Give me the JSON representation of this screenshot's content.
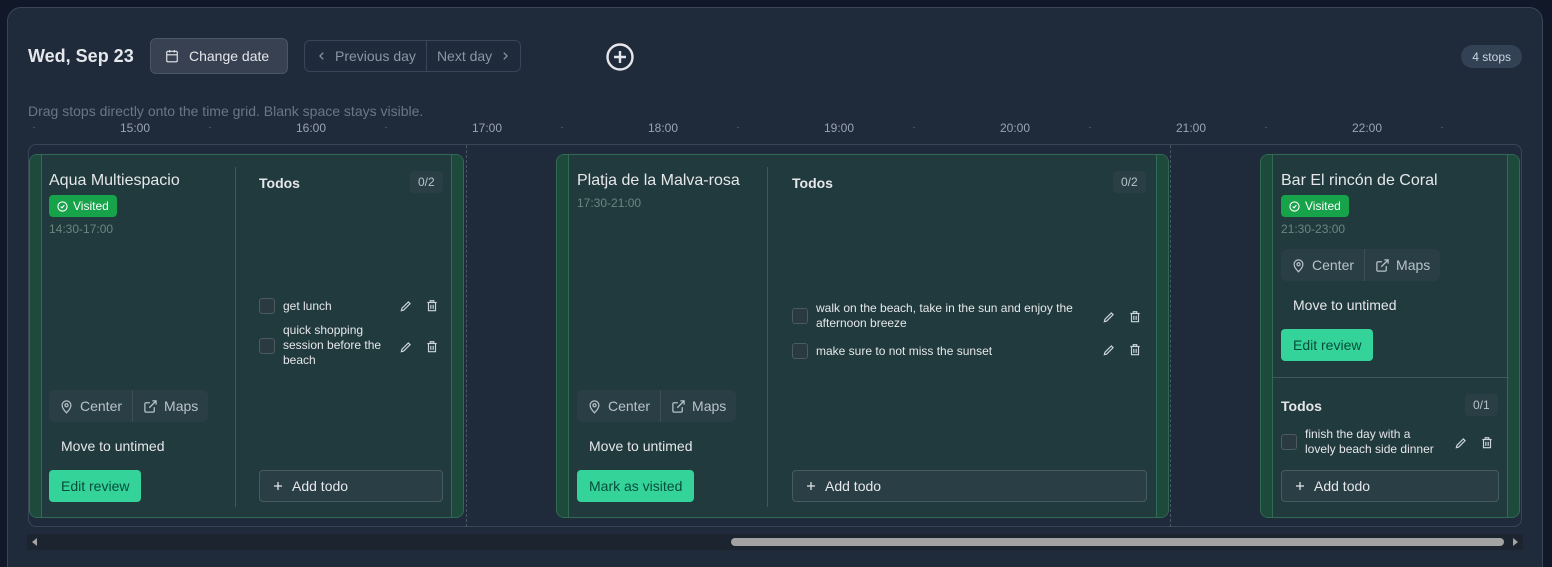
{
  "header": {
    "date": "Wed, Sep 23",
    "change_date": "Change date",
    "previous_day": "Previous day",
    "next_day": "Next day",
    "stops_count": "4 stops"
  },
  "hint": "Drag stops directly onto the time grid. Blank space stays visible.",
  "timeline": {
    "ticks": [
      "15:00",
      "16:00",
      "17:00",
      "18:00",
      "19:00",
      "20:00",
      "21:00",
      "22:00"
    ]
  },
  "stops": [
    {
      "name": "Aqua Multiespacio",
      "visited_label": "Visited",
      "time": "14:30-17:00",
      "center": "Center",
      "maps": "Maps",
      "move_untimed": "Move to untimed",
      "action": "Edit review",
      "todos_title": "Todos",
      "todos_count": "0/2",
      "todos": [
        "get lunch",
        "quick shopping session before the beach"
      ],
      "add_todo": "Add todo"
    },
    {
      "name": "Platja de la Malva-rosa",
      "time": "17:30-21:00",
      "center": "Center",
      "maps": "Maps",
      "move_untimed": "Move to untimed",
      "action": "Mark as visited",
      "todos_title": "Todos",
      "todos_count": "0/2",
      "todos": [
        "walk on the beach, take in the sun and enjoy the afternoon breeze",
        "make sure to not miss the sunset"
      ],
      "add_todo": "Add todo"
    },
    {
      "name": "Bar El rincón de Coral",
      "visited_label": "Visited",
      "time": "21:30-23:00",
      "center": "Center",
      "maps": "Maps",
      "move_untimed": "Move to untimed",
      "action": "Edit review",
      "todos_title": "Todos",
      "todos_count": "0/1",
      "todos": [
        "finish the day with a lovely beach side dinner"
      ],
      "add_todo": "Add todo"
    }
  ],
  "colors": {
    "background": "#111827",
    "panel": "#1f2a3a",
    "card": "#213a3d",
    "accent_green": "#34d399",
    "visited_badge": "#16a34a"
  }
}
